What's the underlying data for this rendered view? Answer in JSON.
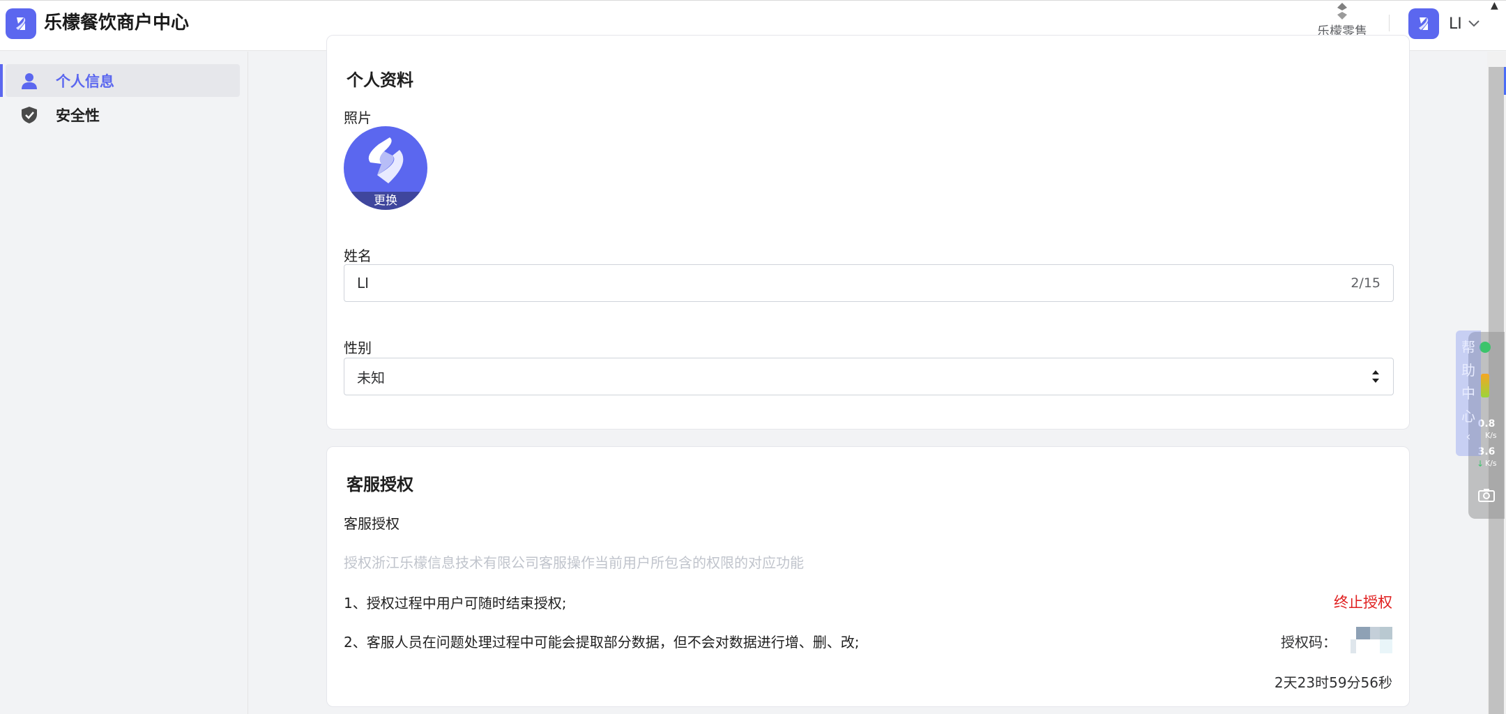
{
  "app": {
    "title": "乐檬餐饮商户中心",
    "brand_color": "#5b67ef"
  },
  "header": {
    "retail_label": "乐檬零售",
    "user_name": "LI"
  },
  "sidebar": {
    "items": [
      {
        "label": "个人信息",
        "icon": "person-icon",
        "active": true
      },
      {
        "label": "安全性",
        "icon": "shield-check-icon",
        "active": false
      }
    ]
  },
  "profile": {
    "title": "个人资料",
    "photo_label": "照片",
    "photo_change": "更换",
    "name_label": "姓名",
    "name_value": "LI",
    "name_counter": "2/15",
    "gender_label": "性别",
    "gender_value": "未知"
  },
  "support": {
    "title": "客服授权",
    "subtitle": "客服授权",
    "description": "授权浙江乐檬信息技术有限公司客服操作当前用户所包含的权限的对应功能",
    "rule_1": "1、授权过程中用户可随时结束授权;",
    "rule_2": "2、客服人员在问题处理过程中可能会提取部分数据，但不会对数据进行增、删、改;",
    "terminate_label": "终止授权",
    "auth_code_label": "授权码：",
    "countdown": "2天23时59分56秒",
    "danger_color": "#e02020"
  },
  "widgets": {
    "help_chars": [
      "帮",
      "助",
      "中",
      "心"
    ],
    "up_rate": "0.8",
    "down_rate": "3.6",
    "rate_unit": "K/s"
  }
}
